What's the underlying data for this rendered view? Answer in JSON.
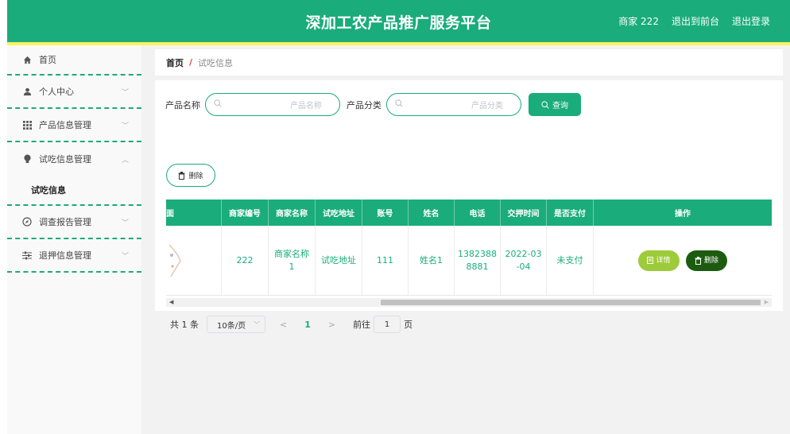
{
  "header": {
    "title": "深加工农产品推广服务平台",
    "user": "商家 222",
    "back_front": "退出到前台",
    "logout": "退出登录"
  },
  "sidebar": {
    "items": [
      {
        "label": "首页",
        "icon": "home-icon"
      },
      {
        "label": "个人中心",
        "icon": "user-icon"
      },
      {
        "label": "产品信息管理",
        "icon": "grid-icon"
      },
      {
        "label": "试吃信息管理",
        "icon": "bulb-icon"
      },
      {
        "label": "调查报告管理",
        "icon": "compass-icon"
      },
      {
        "label": "退押信息管理",
        "icon": "sliders-icon"
      }
    ],
    "sub_item": "试吃信息"
  },
  "breadcrumb": {
    "home": "首页",
    "sep": "/",
    "current": "试吃信息"
  },
  "search": {
    "product_name_label": "产品名称",
    "product_name_placeholder": "产品名称",
    "product_category_label": "产品分类",
    "product_category_placeholder": "产品分类",
    "query_button": "查询"
  },
  "delete_button": "删除",
  "table": {
    "headers": [
      "面",
      "商家编号",
      "商家名称",
      "试吃地址",
      "账号",
      "姓名",
      "电话",
      "交押时间",
      "是否支付",
      "操作"
    ],
    "row": {
      "merchant_no": "222",
      "merchant_name": "商家名称1",
      "tasting_address": "试吃地址",
      "account": "111",
      "name": "姓名1",
      "phone": "13823888881",
      "deposit_time": "2022-03-04",
      "paid": "未支付",
      "detail_button": "详情",
      "delete_button": "删除"
    }
  },
  "pagination": {
    "total": "共 1 条",
    "page_size": "10条/页",
    "prev": "<",
    "current": "1",
    "next": ">",
    "goto_label": "前往",
    "goto_value": "1",
    "page_unit": "页"
  },
  "colors": {
    "primary": "#1aac7b",
    "stripe": "#f7f45c",
    "detail": "#9dcb3a",
    "delete": "#1d5c10",
    "breadcrumb_sep": "#e04141"
  }
}
